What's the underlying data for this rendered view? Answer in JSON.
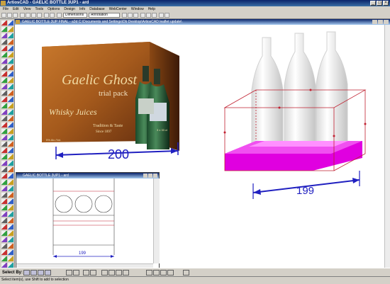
{
  "window": {
    "title": "ArtiosCAD - GAELIC BOTTLE 3UP1 - ard"
  },
  "menu": [
    "File",
    "Edit",
    "View",
    "Tools",
    "Options",
    "Design",
    "Info",
    "Database",
    "WebCenter",
    "Window",
    "Help"
  ],
  "toolbar": {
    "layer_label": "Dimensions",
    "mode_label": "Annotation"
  },
  "document_tab": {
    "title": "GAELIC BOTTLE 3UP FINAL - a3d  C:\\Documents and Settings\\Db Desktop\\ArtiosCAD leaflet update\\"
  },
  "carton": {
    "brand": "Gaelic Ghost",
    "subtitle": "trial pack",
    "product": "Whisky Juices",
    "tagline": "Tradition & Taste",
    "since": "Since 1897",
    "small_left": "5% Alc./Vol.",
    "small_right": "3 x 33 cl",
    "dimension": "200"
  },
  "tray": {
    "dimension": "199"
  },
  "subwindow": {
    "title": "GAELIC BOTTLE 3UP1 - ard",
    "dimension": "199"
  },
  "select_bar": {
    "label": "Select By:"
  },
  "status": {
    "text": "Select item(s), use Shift to add to selection"
  },
  "colors": {
    "tray": "#e000e0",
    "dimension": "#2020c0",
    "carton": "#a0581c",
    "outline": "#c02030"
  }
}
